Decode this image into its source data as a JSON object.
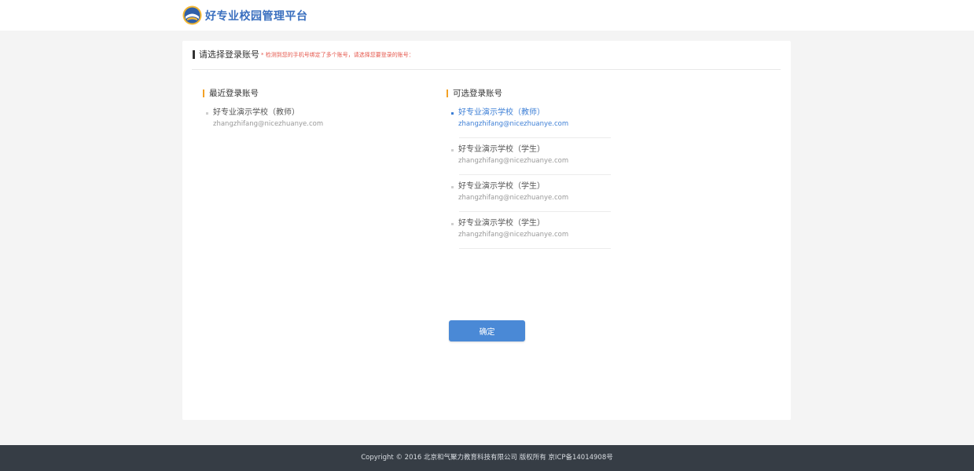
{
  "header": {
    "logo_icon": "school-emblem-icon",
    "title": "好专业校园管理平台"
  },
  "card": {
    "title": "请选择登录账号",
    "note": "* 检测到您的手机号绑定了多个账号，请选择您要登录的账号："
  },
  "recent": {
    "title": "最近登录账号",
    "accounts": [
      {
        "name": "好专业演示学校（教师）",
        "email": "zhangzhifang@nicezhuanye.com"
      }
    ]
  },
  "available": {
    "title": "可选登录账号",
    "accounts": [
      {
        "name": "好专业演示学校（教师）",
        "email": "zhangzhifang@nicezhuanye.com",
        "selected": true
      },
      {
        "name": "好专业演示学校（学生）",
        "email": "zhangzhifang@nicezhuanye.com",
        "selected": false
      },
      {
        "name": "好专业演示学校（学生）",
        "email": "zhangzhifang@nicezhuanye.com",
        "selected": false
      },
      {
        "name": "好专业演示学校（学生）",
        "email": "zhangzhifang@nicezhuanye.com",
        "selected": false
      }
    ]
  },
  "confirm_label": "确定",
  "footer": {
    "text": "Copyright © 2016 北京和气聚力教育科技有限公司 版权所有 京ICP备14014908号"
  },
  "colors": {
    "accent": "#4a89d6",
    "selected": "#3d7fd6",
    "marker": "#f3a125",
    "note": "#e5584d",
    "footer_bg": "#363d45"
  }
}
